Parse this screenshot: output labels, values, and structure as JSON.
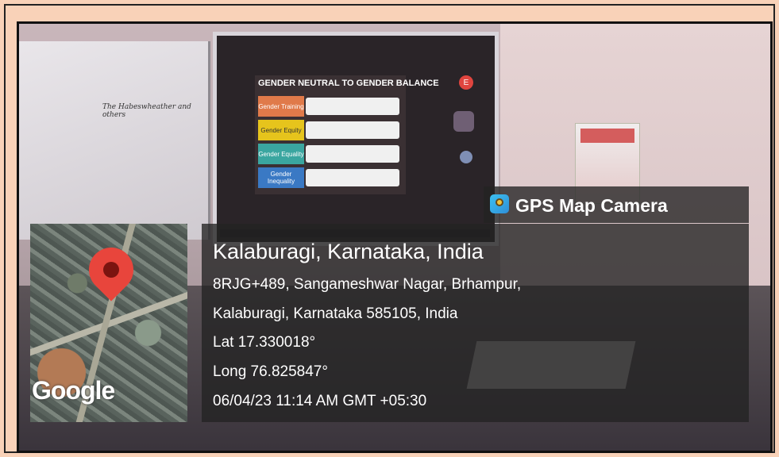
{
  "photo": {
    "whiteboard_text": "The Habeswheather and others",
    "slide_title": "GENDER NEUTRAL TO GENDER BALANCE",
    "slide_rows": [
      {
        "label": "Gender Training",
        "color": "#e07a4a"
      },
      {
        "label": "Gender Equity",
        "color": "#e6c41c"
      },
      {
        "label": "Gender Equality",
        "color": "#3aa6a0"
      },
      {
        "label": "Gender Inequality",
        "color": "#3a79c4"
      }
    ],
    "avatar_letter": "E"
  },
  "overlay": {
    "app_name": "GPS Map Camera",
    "location_title": "Kalaburagi, Karnataka, India",
    "address_line1": "8RJG+489, Sangameshwar Nagar, Brhampur,",
    "address_line2": "Kalaburagi, Karnataka 585105, India",
    "lat": "Lat 17.330018°",
    "long": "Long 76.825847°",
    "datetime": "06/04/23 11:14 AM GMT +05:30",
    "map_brand": "Google"
  }
}
